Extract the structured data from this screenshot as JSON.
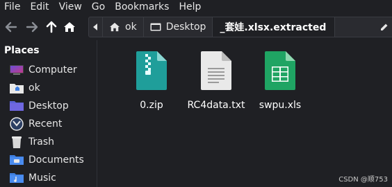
{
  "menu": [
    "File",
    "Edit",
    "View",
    "Go",
    "Bookmarks",
    "Help"
  ],
  "toolbar": {
    "back_icon": "arrow-left-icon",
    "forward_icon": "arrow-right-icon",
    "up_icon": "arrow-up-icon",
    "home_icon": "home-icon",
    "breadcrumbs": [
      {
        "label": "ok",
        "icon": "home-icon"
      },
      {
        "label": "Desktop",
        "icon": "desktop-icon"
      },
      {
        "label": "_套娃.xlsx.extracted",
        "icon": "",
        "active": true
      }
    ],
    "edit_icon": "pencil-icon"
  },
  "sidebar": {
    "heading": "Places",
    "items": [
      {
        "label": "Computer",
        "icon": "computer-icon"
      },
      {
        "label": "ok",
        "icon": "home-folder-icon"
      },
      {
        "label": "Desktop",
        "icon": "desktop-icon"
      },
      {
        "label": "Recent",
        "icon": "recent-icon"
      },
      {
        "label": "Trash",
        "icon": "trash-icon"
      },
      {
        "label": "Documents",
        "icon": "documents-folder-icon"
      },
      {
        "label": "Music",
        "icon": "music-folder-icon"
      }
    ]
  },
  "files": [
    {
      "name": "0.zip",
      "icon": "zip-archive-icon"
    },
    {
      "name": "RC4data.txt",
      "icon": "text-file-icon"
    },
    {
      "name": "swpu.xls",
      "icon": "spreadsheet-icon"
    }
  ],
  "watermark": "CSDN @顺753",
  "colors": {
    "background": "#1f2024",
    "zip": "#1f9e9a",
    "spreadsheet": "#1fa463",
    "folder": "#3f7fe0"
  }
}
